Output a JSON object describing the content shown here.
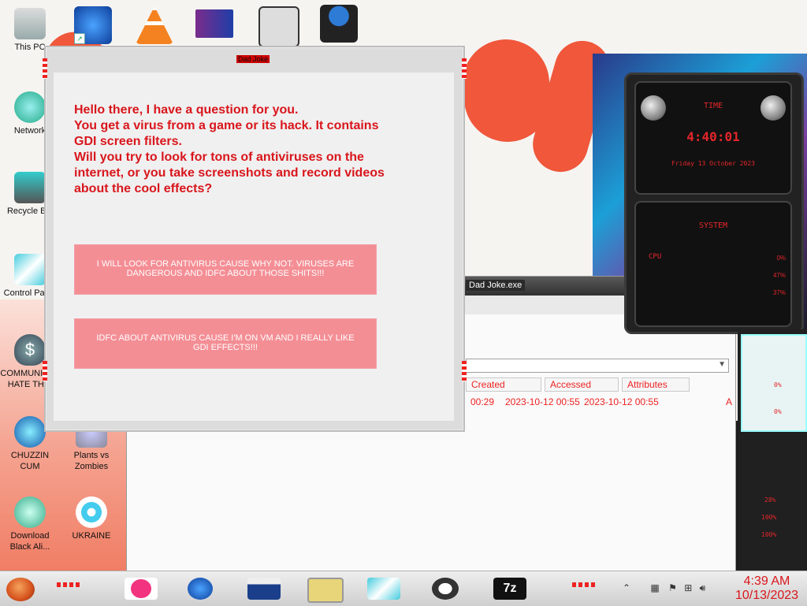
{
  "dialog": {
    "title": "Dad Joke",
    "question": "Hello there, I have a question for you.\nYou get a virus from a game or its hack. It contains\nGDI screen filters.\nWill you try to look for tons of antiviruses on the\ninternet, or you take screenshots and record videos\nabout the cool effects?",
    "choice1": "I WILL LOOK FOR ANTIVIRUS CAUSE WHY NOT. VIRUSES ARE DANGEROUS AND IDFC ABOUT THOSE SHITS!!!",
    "choice2": "IDFC ABOUT ANTIVIRUS CAUSE I'M ON VM AND I REALLY LIKE GDI EFFECTS!!!"
  },
  "background_window": {
    "title": "Dad Joke.exe",
    "columns": [
      "Created",
      "Accessed",
      "Attributes"
    ],
    "row": [
      "00:29",
      "2023-10-12 00:55",
      "2023-10-12 00:55",
      "A"
    ]
  },
  "desktop": {
    "icons": [
      {
        "label": "This PC",
        "icon": "computer-icon"
      },
      {
        "label": "Network",
        "icon": "network-icon"
      },
      {
        "label": "Recycle Bin",
        "icon": "recycle-bin-icon"
      },
      {
        "label": "Control Panel",
        "icon": "control-panel-icon"
      },
      {
        "label": "COMMUNISTS HATE THIS",
        "icon": "money-bag-icon"
      },
      {
        "label": "CHUZZIN CUM",
        "icon": "chuzzle-icon"
      },
      {
        "label": "Plants vs Zombies",
        "icon": "plants-vs-zombies-icon"
      },
      {
        "label": "Download Black Ali...",
        "icon": "alien-download-icon"
      },
      {
        "label": "UKRAINE",
        "icon": "radiation-icon"
      }
    ],
    "top_row_icons": [
      "firefox-icon",
      "vlc-icon",
      "hxd-icon",
      "app-icon",
      "agent-icon"
    ]
  },
  "gadget": {
    "time_label": "TIME",
    "time": "4:40:01",
    "date": "Friday 13 October 2023",
    "system_label": "SYSTEM",
    "cpu_label": "CPU",
    "cpu_value": "0%",
    "mem_value": "47%",
    "disk_value": "37%",
    "side_values": [
      "0%",
      "0%",
      "28%",
      "100%",
      "100%"
    ]
  },
  "taskbar": {
    "apps": [
      "notes-icon",
      "firefox-icon",
      "file-explorer-icon",
      "id-card-icon",
      "control-panel-icon",
      "obs-icon",
      "7zip-icon"
    ],
    "time": "4:39 AM",
    "date": "10/13/2023"
  },
  "colors": {
    "accent_red": "#d9161c",
    "button_pink": "#f48e95"
  }
}
